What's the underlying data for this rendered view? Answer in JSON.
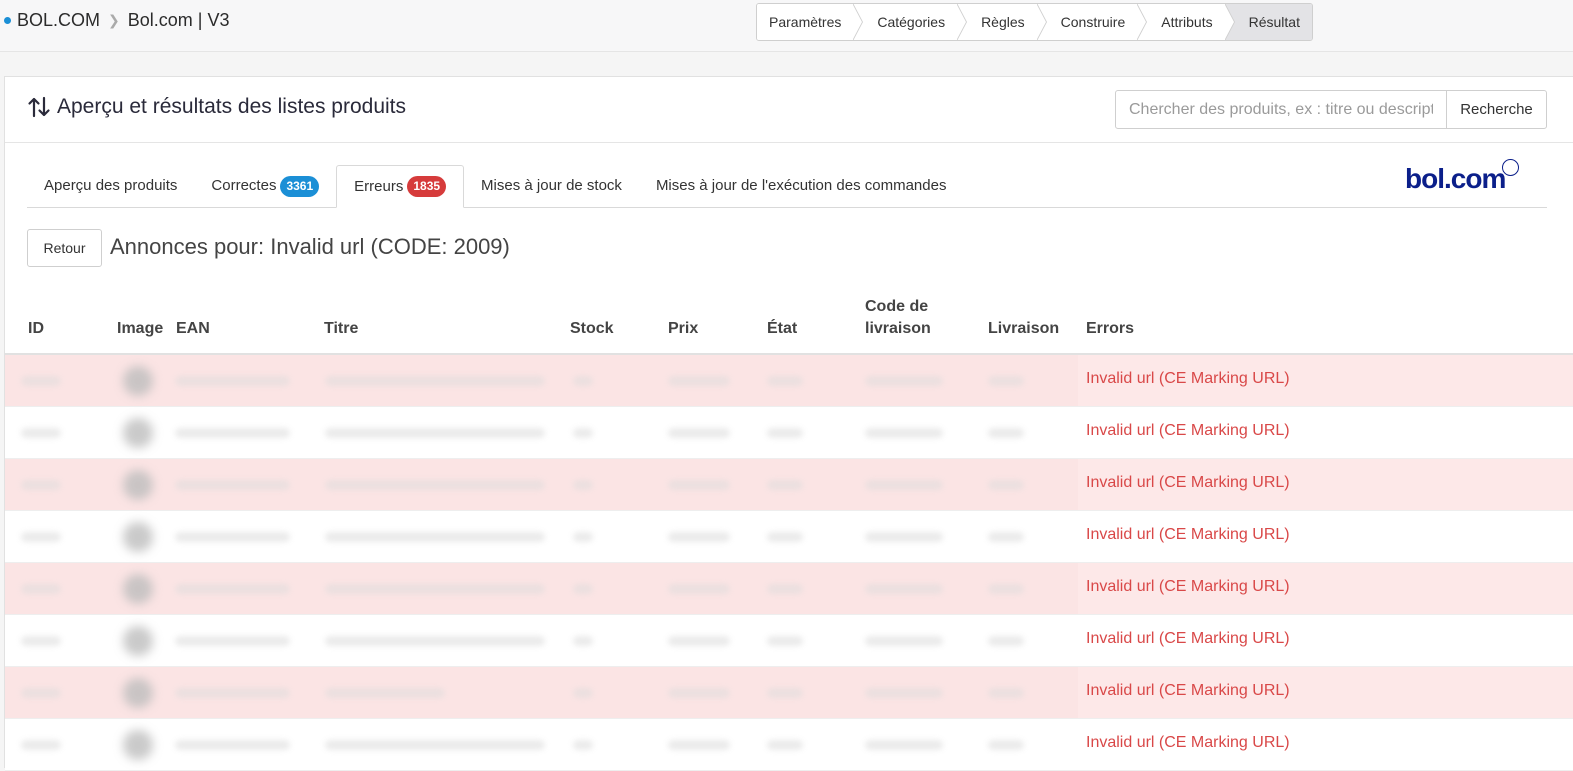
{
  "breadcrumb": {
    "root": "BOL.COM",
    "current": "Bol.com | V3"
  },
  "steps": [
    "Paramètres",
    "Catégories",
    "Règles",
    "Construire",
    "Attributs",
    "Résultat"
  ],
  "panel": {
    "title": "Aperçu et résultats des listes produits",
    "search_placeholder": "Chercher des produits, ex : titre ou description",
    "search_button": "Recherche"
  },
  "tabs": {
    "overview": "Aperçu des produits",
    "correct": "Correctes",
    "correct_count": "3361",
    "errors": "Erreurs",
    "errors_count": "1835",
    "stock": "Mises à jour de stock",
    "orders": "Mises à jour de l'exécution des commandes"
  },
  "logo": "bol.com",
  "retour_button": "Retour",
  "annonces_title": "Annonces pour: Invalid url (CODE: 2009)",
  "table": {
    "headers": {
      "id": "ID",
      "image": "Image",
      "ean": "EAN",
      "titre": "Titre",
      "stock": "Stock",
      "prix": "Prix",
      "etat": "État",
      "code_livraison_1": "Code de",
      "code_livraison_2": "livraison",
      "livraison": "Livraison",
      "errors": "Errors"
    },
    "rows": [
      {
        "error": "Invalid url (CE Marking URL)"
      },
      {
        "error": "Invalid url (CE Marking URL)"
      },
      {
        "error": "Invalid url (CE Marking URL)"
      },
      {
        "error": "Invalid url (CE Marking URL)"
      },
      {
        "error": "Invalid url (CE Marking URL)"
      },
      {
        "error": "Invalid url (CE Marking URL)"
      },
      {
        "error": "Invalid url (CE Marking URL)"
      },
      {
        "error": "Invalid url (CE Marking URL)"
      }
    ]
  },
  "colors": {
    "accent": "#1b8fd6",
    "error": "#d94848",
    "error_row": "#fde8e8",
    "logo": "#0b1f8a"
  }
}
